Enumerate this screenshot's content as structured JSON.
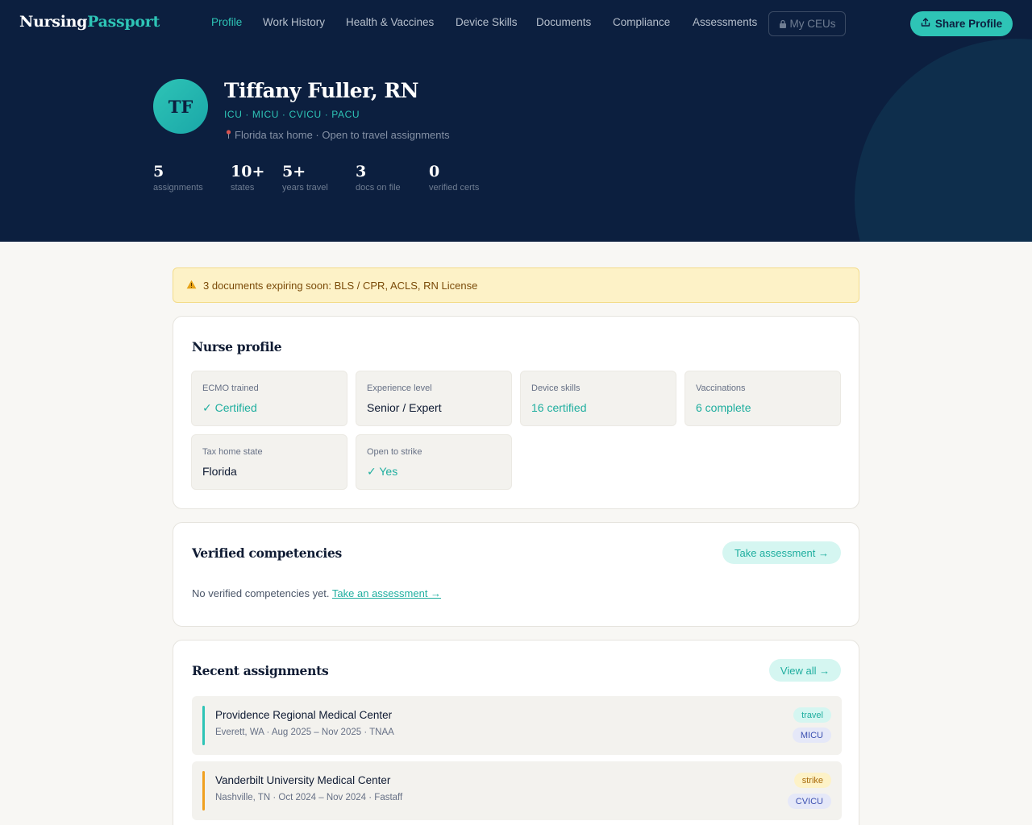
{
  "brand": {
    "part1": "Nursing",
    "part2": "Passport"
  },
  "nav": {
    "items": [
      {
        "label": "Profile",
        "active": true
      },
      {
        "label": "Work History",
        "active": false
      },
      {
        "label": "Health & Vaccines",
        "active": false
      },
      {
        "label": "Device Skills",
        "active": false
      },
      {
        "label": "Documents",
        "active": false
      },
      {
        "label": "Compliance",
        "active": false
      },
      {
        "label": "Assessments",
        "active": false
      }
    ],
    "locked_item": "My CEUs",
    "share_label": "Share Profile"
  },
  "profile": {
    "initials": "TF",
    "name": "Tiffany Fuller, RN",
    "specialties": "ICU · MICU · CVICU · PACU",
    "location": "Florida tax home · Open to travel assignments"
  },
  "stats": [
    {
      "value": "5",
      "label": "assignments"
    },
    {
      "value": "10+",
      "label": "states"
    },
    {
      "value": "5+",
      "label": "years travel"
    },
    {
      "value": "3",
      "label": "docs on file"
    },
    {
      "value": "0",
      "label": "verified certs"
    }
  ],
  "alert": {
    "text": "3 documents expiring soon: BLS / CPR, ACLS, RN License"
  },
  "nurse_profile": {
    "title": "Nurse profile",
    "tiles": [
      {
        "label": "ECMO trained",
        "value": "✓ Certified",
        "highlight": true
      },
      {
        "label": "Experience level",
        "value": "Senior / Expert",
        "highlight": false
      },
      {
        "label": "Device skills",
        "value": "16 certified",
        "highlight": true
      },
      {
        "label": "Vaccinations",
        "value": "6 complete",
        "highlight": true
      },
      {
        "label": "Tax home state",
        "value": "Florida",
        "highlight": false
      },
      {
        "label": "Open to strike",
        "value": "✓ Yes",
        "highlight": true
      }
    ]
  },
  "competencies": {
    "title": "Verified competencies",
    "button": "Take assessment →",
    "empty_text": "No verified competencies yet.",
    "empty_link": "Take an assessment →"
  },
  "assignments": {
    "title": "Recent assignments",
    "button": "View all →",
    "items": [
      {
        "facility": "Providence Regional Medical Center",
        "details": "Everett, WA · Aug 2025 – Nov 2025 · TNAA",
        "type": "travel",
        "unit": "MICU",
        "bar_color": "#2ec4b6"
      },
      {
        "facility": "Vanderbilt University Medical Center",
        "details": "Nashville, TN · Oct 2024 – Nov 2024 · Fastaff",
        "type": "strike",
        "unit": "CVICU",
        "bar_color": "#f0a020"
      }
    ]
  },
  "colors": {
    "accent": "#2ec4b6",
    "header_bg": "#0c1f3f",
    "warning_bg": "#fdf2c7"
  }
}
